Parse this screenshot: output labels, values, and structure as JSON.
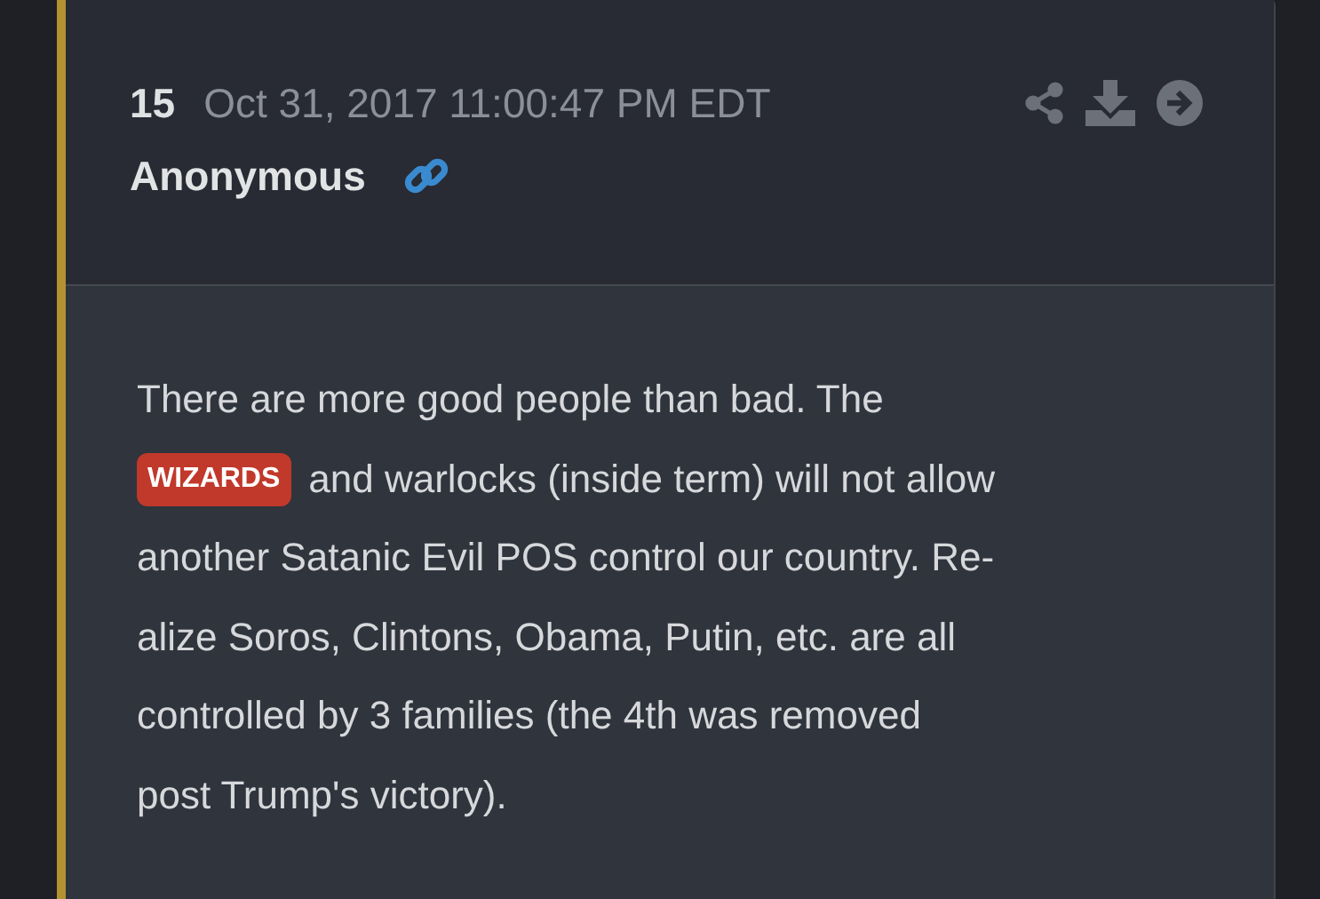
{
  "post": {
    "number": "15",
    "timestamp": "Oct 31, 2017 11:00:47 PM EDT",
    "author": "Anonymous",
    "body_lines": [
      [
        {
          "kind": "text",
          "text": "There are more good people than bad. The"
        }
      ],
      [
        {
          "kind": "tag",
          "text": "WIZARDS"
        },
        {
          "kind": "text",
          "text": "and warlocks (inside term) will not allow"
        }
      ],
      [
        {
          "kind": "text",
          "text": "another Satanic Evil POS control our country. Re-"
        }
      ],
      [
        {
          "kind": "text",
          "text": "alize Soros, Clintons, Obama, Putin, etc. are all"
        }
      ],
      [
        {
          "kind": "text",
          "text": "controlled by 3 families (the 4th was removed"
        }
      ],
      [
        {
          "kind": "text",
          "text": "post Trump's victory)."
        }
      ]
    ]
  }
}
